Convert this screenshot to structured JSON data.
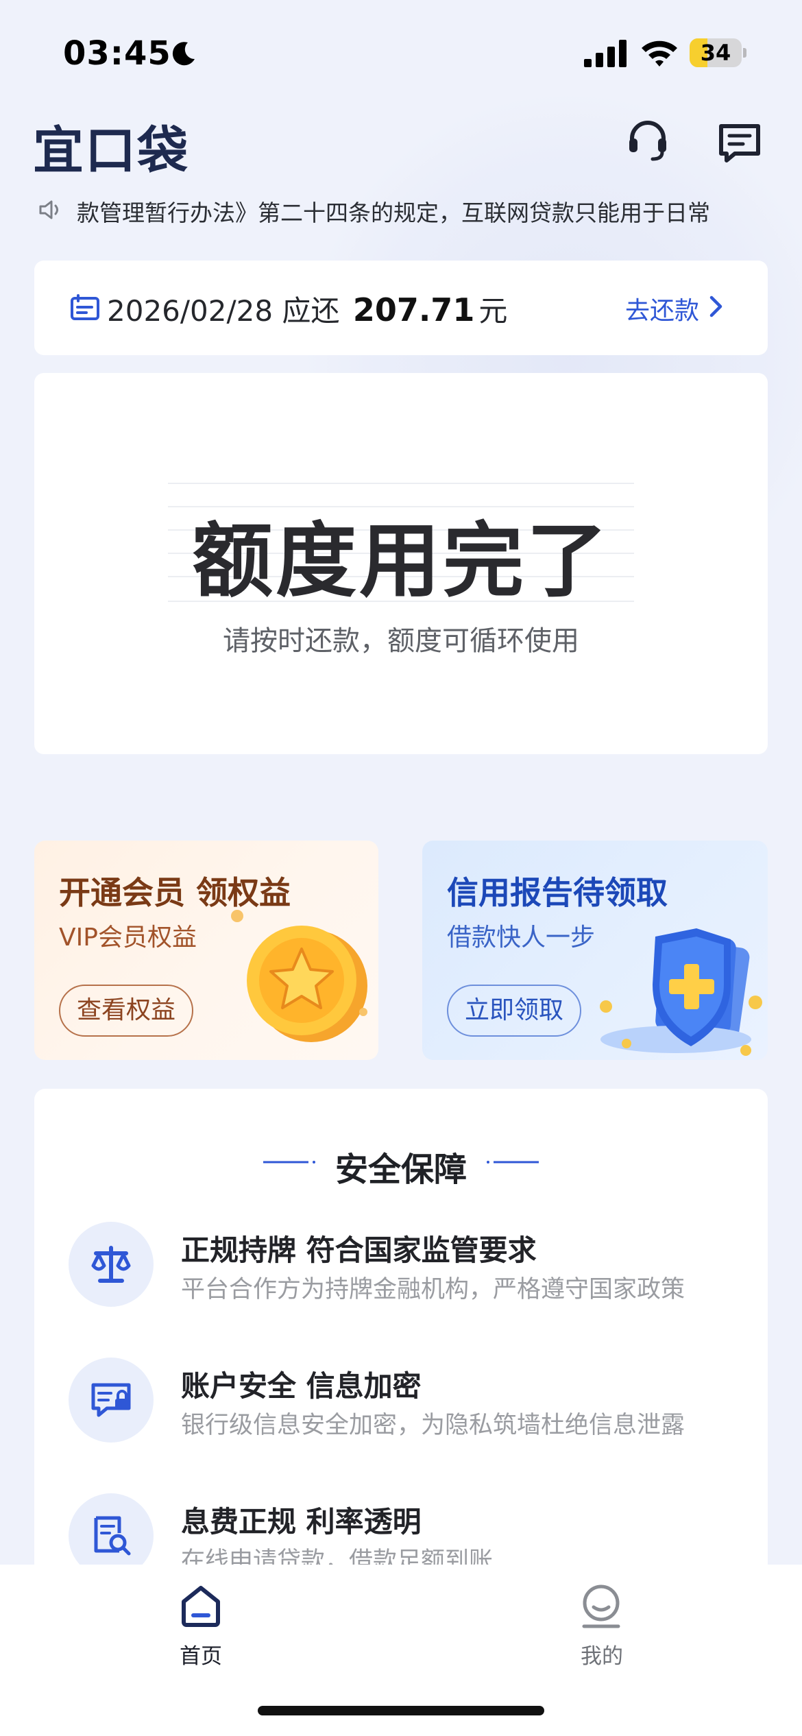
{
  "status_bar": {
    "time": "03:45",
    "battery_level": "34",
    "battery_fraction": 0.34,
    "icons": [
      "moon-icon",
      "signal-icon",
      "wifi-icon",
      "battery-icon"
    ]
  },
  "header": {
    "logo": "宜口袋",
    "icons": [
      "headset-icon",
      "message-icon"
    ]
  },
  "notice": {
    "text": "款管理暂行办法》第二十四条的规定，互联网贷款只能用于日常",
    "icon": "speaker-icon"
  },
  "repay": {
    "date": "2026/02/28",
    "due_label": "应还",
    "amount": "207.71",
    "unit": "元",
    "action": "去还款"
  },
  "quota": {
    "title": "额度用完了",
    "subtitle": "请按时还款，额度可循环使用"
  },
  "promos": [
    {
      "title": "开通会员 领权益",
      "subtitle": "VIP会员权益",
      "button": "查看权益"
    },
    {
      "title": "信用报告待领取",
      "subtitle": "借款快人一步",
      "button": "立即领取"
    }
  ],
  "security": {
    "title": "安全保障",
    "items": [
      {
        "title": "正规持牌 符合国家监管要求",
        "desc": "平台合作方为持牌金融机构，严格遵守国家政策",
        "icon": "scale-icon"
      },
      {
        "title": "账户安全 信息加密",
        "desc": "银行级信息安全加密，为隐私筑墙杜绝信息泄露",
        "icon": "secure-card-icon"
      },
      {
        "title": "息费正规  利率透明",
        "desc": "在线申请贷款，借款足额到账",
        "icon": "document-search-icon"
      }
    ]
  },
  "tabs": [
    {
      "label": "首页",
      "icon": "home-icon",
      "active": true
    },
    {
      "label": "我的",
      "icon": "profile-icon",
      "active": false
    }
  ],
  "colors": {
    "accent": "#2f57d6",
    "background": "#eff2fb",
    "promo_gold": "#7a3a16",
    "promo_blue": "#1c48b8"
  }
}
